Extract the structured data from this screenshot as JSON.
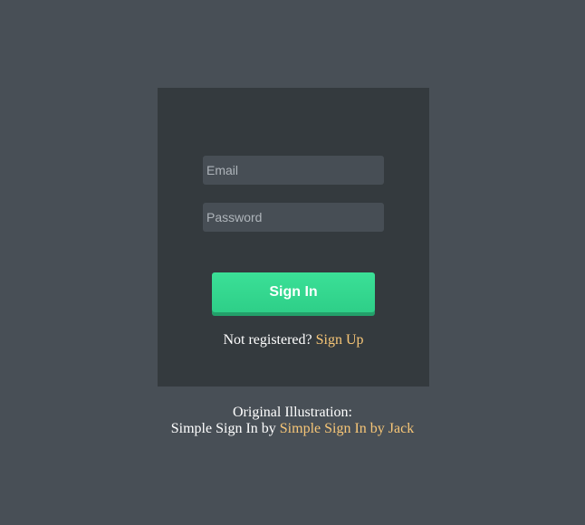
{
  "form": {
    "email_placeholder": "Email",
    "password_placeholder": "Password",
    "signin_label": "Sign In",
    "not_registered_text": "Not registered?",
    "signup_label": "Sign Up"
  },
  "credits": {
    "line1": "Original Illustration:",
    "line2_prefix": "Simple Sign In by",
    "link_label": "Simple Sign In by Jack"
  },
  "colors": {
    "page_background": "#484f56",
    "card_background": "#343a3e",
    "input_background": "#474e55",
    "button_green": "#34d890",
    "link_accent": "#f7c677"
  }
}
